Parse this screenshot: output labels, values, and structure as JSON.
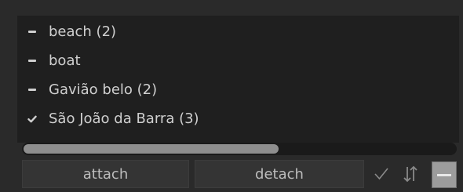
{
  "list": {
    "items": [
      {
        "label": "beach (2)",
        "state": "partial"
      },
      {
        "label": "boat",
        "state": "partial"
      },
      {
        "label": "Gavião belo (2)",
        "state": "partial"
      },
      {
        "label": "São João da Barra (3)",
        "state": "checked"
      }
    ]
  },
  "scrollbar": {
    "thumb_fraction": 0.59
  },
  "toolbar": {
    "attach_label": "attach",
    "detach_label": "detach",
    "check_icon": "check-icon",
    "sort_icon": "sort-icon",
    "collapse_icon": "collapse-icon"
  },
  "colors": {
    "background": "#2a2a2a",
    "panel": "#1f1f1f",
    "text": "#cfcfcf",
    "button": "#343434",
    "active_tool": "#9c9c9c"
  }
}
